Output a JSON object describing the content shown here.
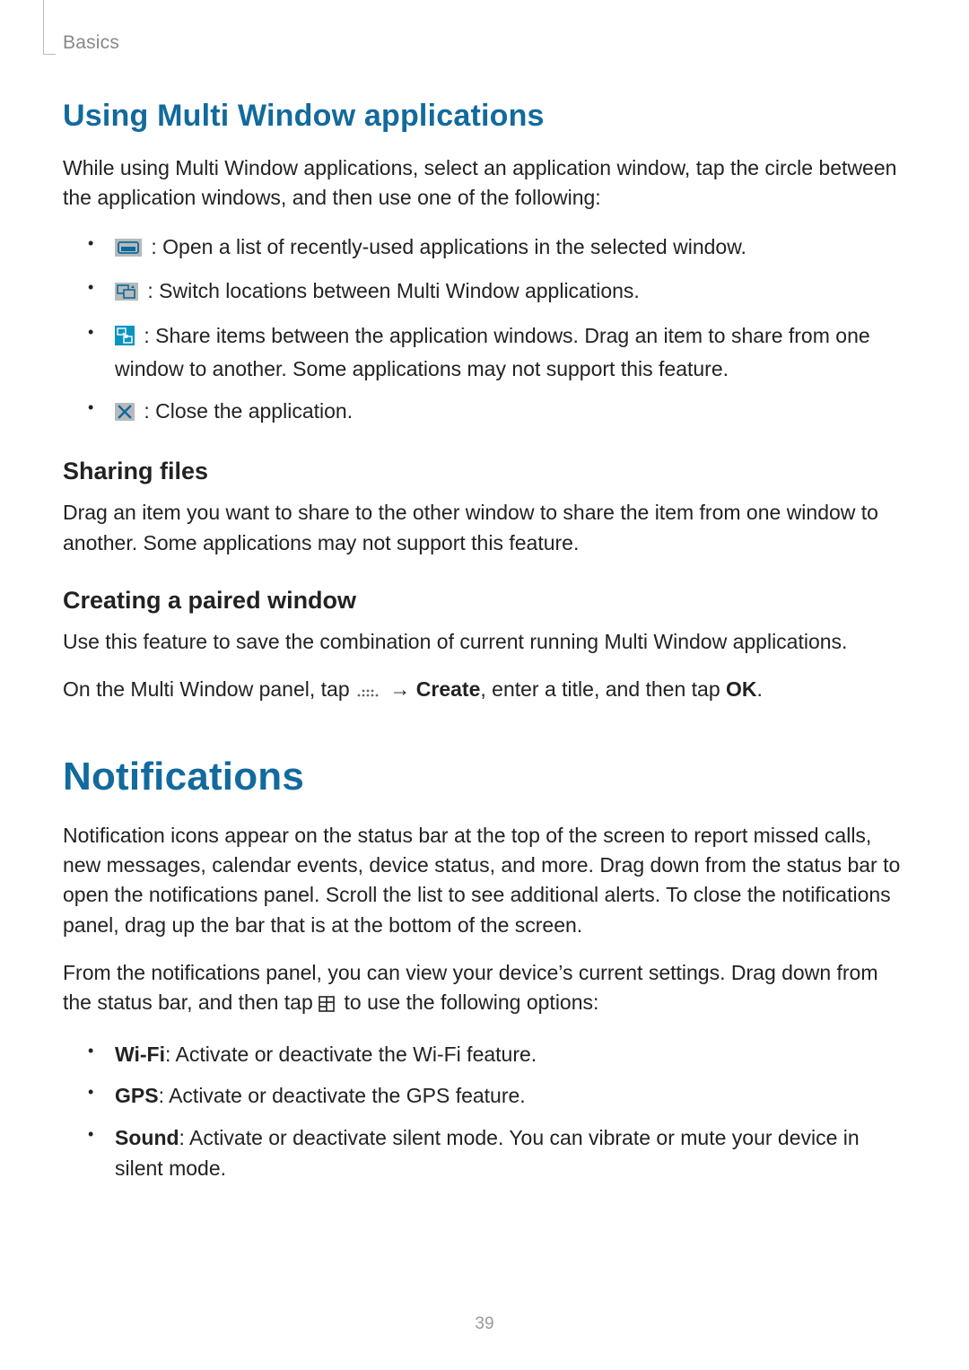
{
  "header": {
    "section": "Basics"
  },
  "section1": {
    "title": "Using Multi Window applications",
    "intro": "While using Multi Window applications, select an application window, tap the circle between the application windows, and then use one of the following:",
    "bullets": [
      {
        "icon": "recent-apps-icon",
        "text": " : Open a list of recently-used applications in the selected window."
      },
      {
        "icon": "swap-windows-icon",
        "text": " : Switch locations between Multi Window applications."
      },
      {
        "icon": "share-item-icon",
        "text": " : Share items between the application windows. Drag an item to share from one window to another. Some applications may not support this feature."
      },
      {
        "icon": "close-x-icon",
        "text": " : Close the application."
      }
    ],
    "sub1": {
      "title": "Sharing files",
      "body": "Drag an item you want to share to the other window to share the item from one window to another. Some applications may not support this feature."
    },
    "sub2": {
      "title": "Creating a paired window",
      "p1": "Use this feature to save the combination of current running Multi Window applications.",
      "p2_pre": "On the Multi Window panel, tap ",
      "p2_arrow": " → ",
      "p2_bold1": "Create",
      "p2_mid": ", enter a title, and then tap ",
      "p2_bold2": "OK",
      "p2_end": "."
    }
  },
  "section2": {
    "title": "Notifications",
    "p1": "Notification icons appear on the status bar at the top of the screen to report missed calls, new messages, calendar events, device status, and more. Drag down from the status bar to open the notifications panel. Scroll the list to see additional alerts. To close the notifications panel, drag up the bar that is at the bottom of the screen.",
    "p2_pre": "From the notifications panel, you can view your device’s current settings. Drag down from the status bar, and then tap ",
    "p2_post": " to use the following options:",
    "options": [
      {
        "bold": "Wi-Fi",
        "text": ": Activate or deactivate the Wi-Fi feature."
      },
      {
        "bold": "GPS",
        "text": ": Activate or deactivate the GPS feature."
      },
      {
        "bold": "Sound",
        "text": ": Activate or deactivate silent mode. You can vibrate or mute your device in silent mode."
      }
    ]
  },
  "page_number": "39"
}
